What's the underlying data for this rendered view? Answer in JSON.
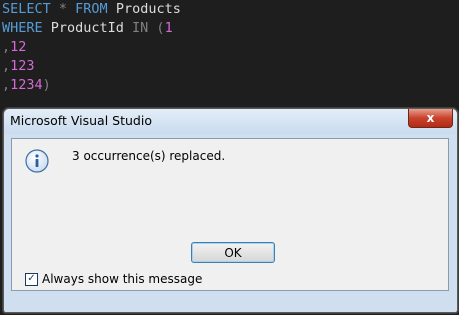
{
  "editor": {
    "lines": [
      [
        {
          "c": "kw",
          "t": "SELECT"
        },
        {
          "c": "op",
          "t": " * "
        },
        {
          "c": "kw",
          "t": "FROM"
        },
        {
          "c": "id",
          "t": " Products"
        }
      ],
      [
        {
          "c": "kw",
          "t": "WHERE"
        },
        {
          "c": "id",
          "t": " ProductId "
        },
        {
          "c": "op",
          "t": "IN ("
        },
        {
          "c": "num",
          "t": "1"
        }
      ],
      [
        {
          "c": "op",
          "t": ","
        },
        {
          "c": "num",
          "t": "12"
        }
      ],
      [
        {
          "c": "op",
          "t": ","
        },
        {
          "c": "num",
          "t": "123"
        }
      ],
      [
        {
          "c": "op",
          "t": ","
        },
        {
          "c": "num",
          "t": "1234"
        },
        {
          "c": "op",
          "t": ")"
        }
      ]
    ]
  },
  "dialog": {
    "title": "Microsoft Visual Studio",
    "close_glyph": "x",
    "icon": "info-icon",
    "message": "3 occurrence(s) replaced.",
    "ok_label": "OK",
    "checkbox_label": "Always show this message",
    "checkbox_checked": true
  }
}
